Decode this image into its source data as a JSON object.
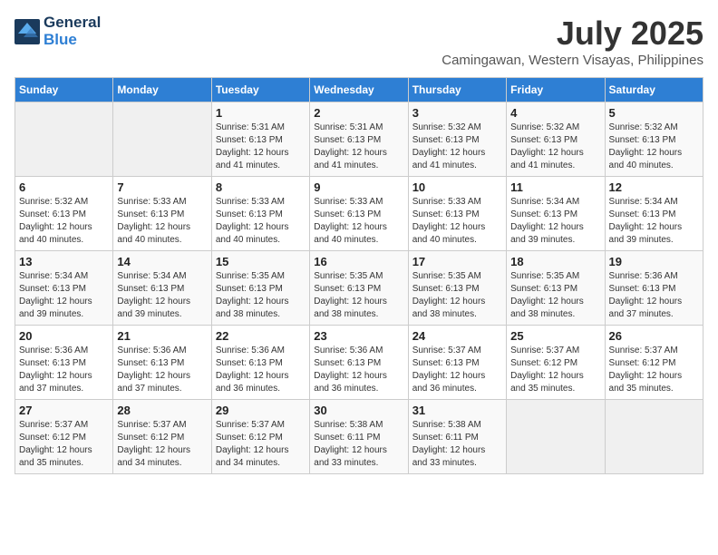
{
  "header": {
    "logo_line1": "General",
    "logo_line2": "Blue",
    "month_year": "July 2025",
    "location": "Camingawan, Western Visayas, Philippines"
  },
  "columns": [
    "Sunday",
    "Monday",
    "Tuesday",
    "Wednesday",
    "Thursday",
    "Friday",
    "Saturday"
  ],
  "weeks": [
    [
      {
        "day": "",
        "sunrise": "",
        "sunset": "",
        "daylight": ""
      },
      {
        "day": "",
        "sunrise": "",
        "sunset": "",
        "daylight": ""
      },
      {
        "day": "1",
        "sunrise": "Sunrise: 5:31 AM",
        "sunset": "Sunset: 6:13 PM",
        "daylight": "Daylight: 12 hours and 41 minutes."
      },
      {
        "day": "2",
        "sunrise": "Sunrise: 5:31 AM",
        "sunset": "Sunset: 6:13 PM",
        "daylight": "Daylight: 12 hours and 41 minutes."
      },
      {
        "day": "3",
        "sunrise": "Sunrise: 5:32 AM",
        "sunset": "Sunset: 6:13 PM",
        "daylight": "Daylight: 12 hours and 41 minutes."
      },
      {
        "day": "4",
        "sunrise": "Sunrise: 5:32 AM",
        "sunset": "Sunset: 6:13 PM",
        "daylight": "Daylight: 12 hours and 41 minutes."
      },
      {
        "day": "5",
        "sunrise": "Sunrise: 5:32 AM",
        "sunset": "Sunset: 6:13 PM",
        "daylight": "Daylight: 12 hours and 40 minutes."
      }
    ],
    [
      {
        "day": "6",
        "sunrise": "Sunrise: 5:32 AM",
        "sunset": "Sunset: 6:13 PM",
        "daylight": "Daylight: 12 hours and 40 minutes."
      },
      {
        "day": "7",
        "sunrise": "Sunrise: 5:33 AM",
        "sunset": "Sunset: 6:13 PM",
        "daylight": "Daylight: 12 hours and 40 minutes."
      },
      {
        "day": "8",
        "sunrise": "Sunrise: 5:33 AM",
        "sunset": "Sunset: 6:13 PM",
        "daylight": "Daylight: 12 hours and 40 minutes."
      },
      {
        "day": "9",
        "sunrise": "Sunrise: 5:33 AM",
        "sunset": "Sunset: 6:13 PM",
        "daylight": "Daylight: 12 hours and 40 minutes."
      },
      {
        "day": "10",
        "sunrise": "Sunrise: 5:33 AM",
        "sunset": "Sunset: 6:13 PM",
        "daylight": "Daylight: 12 hours and 40 minutes."
      },
      {
        "day": "11",
        "sunrise": "Sunrise: 5:34 AM",
        "sunset": "Sunset: 6:13 PM",
        "daylight": "Daylight: 12 hours and 39 minutes."
      },
      {
        "day": "12",
        "sunrise": "Sunrise: 5:34 AM",
        "sunset": "Sunset: 6:13 PM",
        "daylight": "Daylight: 12 hours and 39 minutes."
      }
    ],
    [
      {
        "day": "13",
        "sunrise": "Sunrise: 5:34 AM",
        "sunset": "Sunset: 6:13 PM",
        "daylight": "Daylight: 12 hours and 39 minutes."
      },
      {
        "day": "14",
        "sunrise": "Sunrise: 5:34 AM",
        "sunset": "Sunset: 6:13 PM",
        "daylight": "Daylight: 12 hours and 39 minutes."
      },
      {
        "day": "15",
        "sunrise": "Sunrise: 5:35 AM",
        "sunset": "Sunset: 6:13 PM",
        "daylight": "Daylight: 12 hours and 38 minutes."
      },
      {
        "day": "16",
        "sunrise": "Sunrise: 5:35 AM",
        "sunset": "Sunset: 6:13 PM",
        "daylight": "Daylight: 12 hours and 38 minutes."
      },
      {
        "day": "17",
        "sunrise": "Sunrise: 5:35 AM",
        "sunset": "Sunset: 6:13 PM",
        "daylight": "Daylight: 12 hours and 38 minutes."
      },
      {
        "day": "18",
        "sunrise": "Sunrise: 5:35 AM",
        "sunset": "Sunset: 6:13 PM",
        "daylight": "Daylight: 12 hours and 38 minutes."
      },
      {
        "day": "19",
        "sunrise": "Sunrise: 5:36 AM",
        "sunset": "Sunset: 6:13 PM",
        "daylight": "Daylight: 12 hours and 37 minutes."
      }
    ],
    [
      {
        "day": "20",
        "sunrise": "Sunrise: 5:36 AM",
        "sunset": "Sunset: 6:13 PM",
        "daylight": "Daylight: 12 hours and 37 minutes."
      },
      {
        "day": "21",
        "sunrise": "Sunrise: 5:36 AM",
        "sunset": "Sunset: 6:13 PM",
        "daylight": "Daylight: 12 hours and 37 minutes."
      },
      {
        "day": "22",
        "sunrise": "Sunrise: 5:36 AM",
        "sunset": "Sunset: 6:13 PM",
        "daylight": "Daylight: 12 hours and 36 minutes."
      },
      {
        "day": "23",
        "sunrise": "Sunrise: 5:36 AM",
        "sunset": "Sunset: 6:13 PM",
        "daylight": "Daylight: 12 hours and 36 minutes."
      },
      {
        "day": "24",
        "sunrise": "Sunrise: 5:37 AM",
        "sunset": "Sunset: 6:13 PM",
        "daylight": "Daylight: 12 hours and 36 minutes."
      },
      {
        "day": "25",
        "sunrise": "Sunrise: 5:37 AM",
        "sunset": "Sunset: 6:12 PM",
        "daylight": "Daylight: 12 hours and 35 minutes."
      },
      {
        "day": "26",
        "sunrise": "Sunrise: 5:37 AM",
        "sunset": "Sunset: 6:12 PM",
        "daylight": "Daylight: 12 hours and 35 minutes."
      }
    ],
    [
      {
        "day": "27",
        "sunrise": "Sunrise: 5:37 AM",
        "sunset": "Sunset: 6:12 PM",
        "daylight": "Daylight: 12 hours and 35 minutes."
      },
      {
        "day": "28",
        "sunrise": "Sunrise: 5:37 AM",
        "sunset": "Sunset: 6:12 PM",
        "daylight": "Daylight: 12 hours and 34 minutes."
      },
      {
        "day": "29",
        "sunrise": "Sunrise: 5:37 AM",
        "sunset": "Sunset: 6:12 PM",
        "daylight": "Daylight: 12 hours and 34 minutes."
      },
      {
        "day": "30",
        "sunrise": "Sunrise: 5:38 AM",
        "sunset": "Sunset: 6:11 PM",
        "daylight": "Daylight: 12 hours and 33 minutes."
      },
      {
        "day": "31",
        "sunrise": "Sunrise: 5:38 AM",
        "sunset": "Sunset: 6:11 PM",
        "daylight": "Daylight: 12 hours and 33 minutes."
      },
      {
        "day": "",
        "sunrise": "",
        "sunset": "",
        "daylight": ""
      },
      {
        "day": "",
        "sunrise": "",
        "sunset": "",
        "daylight": ""
      }
    ]
  ]
}
